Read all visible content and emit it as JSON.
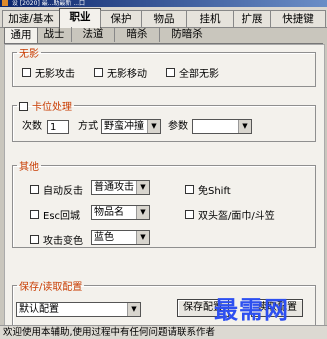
{
  "window": {
    "title": "设 [2020] 最...助最新 ...口"
  },
  "main_tabs": [
    "加速/基本",
    "职业",
    "保护",
    "物品",
    "挂机",
    "扩展",
    "快捷键"
  ],
  "sub_tabs": [
    "通用",
    "战士",
    "法道",
    "暗杀",
    "防暗杀"
  ],
  "group_no_shadow": {
    "legend": "无影",
    "options": [
      "无影攻击",
      "无影移动",
      "全部无影"
    ]
  },
  "group_stuck": {
    "legend": "卡位处理",
    "count_label": "次数",
    "count_value": "1",
    "mode_label": "方式",
    "mode_value": "野蛮冲撞",
    "param_label": "参数",
    "param_value": ""
  },
  "group_other": {
    "legend": "其他",
    "auto_counter": {
      "label": "自动反击",
      "select": "普通攻击"
    },
    "esc_return": {
      "label": "Esc回城",
      "select": "物品名"
    },
    "attack_color": {
      "label": "攻击变色",
      "select": "蓝色"
    },
    "no_shift": {
      "label": "免Shift"
    },
    "double_head": {
      "label": "双头盔/面巾/斗笠"
    }
  },
  "config": {
    "legend": "保存/读取配置",
    "select_value": "默认配置",
    "save_button": "保存配置",
    "load_button": "读取配置"
  },
  "status": {
    "text": "欢迎使用本辅助,使用过程中有任何问题请联系作者"
  },
  "watermark": {
    "text": "最需网"
  },
  "colors": {
    "legend": "#c83b00",
    "watermark": "#2d4ff0"
  }
}
